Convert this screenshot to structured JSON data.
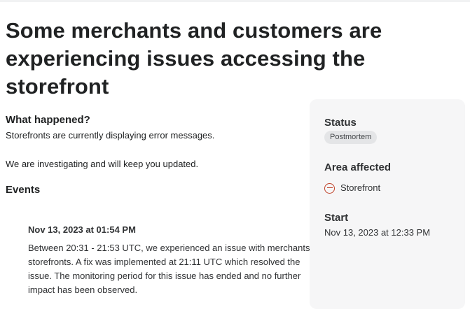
{
  "incident": {
    "title": "Some merchants and customers are experiencing issues accessing the storefront"
  },
  "what_happened": {
    "heading": "What happened?",
    "lines": [
      "Storefronts are currently displaying error messages.",
      "We are investigating and will keep you updated."
    ]
  },
  "events": {
    "heading": "Events",
    "items": [
      {
        "timestamp": "Nov 13, 2023 at 01:54 PM",
        "description": "Between 20:31 - 21:53 UTC, we experienced an issue with merchants' storefronts. A fix was implemented at 21:11 UTC which resolved the issue. The monitoring period for this issue has ended and no further impact has been observed."
      }
    ]
  },
  "sidebar": {
    "status_label": "Status",
    "status_value": "Postmortem",
    "area_label": "Area affected",
    "area_items": [
      {
        "label": "Storefront",
        "icon": "minus-circle-icon",
        "icon_color": "#c0432b"
      }
    ],
    "start_label": "Start",
    "start_value": "Nov 13, 2023 at 12:33 PM"
  }
}
